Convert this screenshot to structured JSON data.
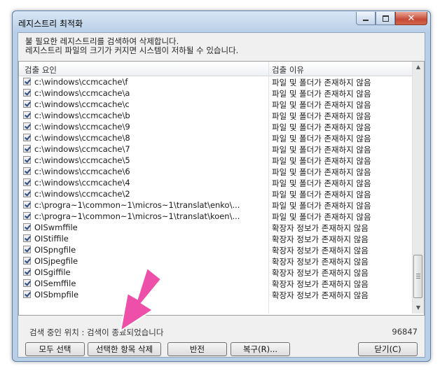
{
  "window": {
    "title": "레지스트리 최적화",
    "close_glyph": "✕"
  },
  "description": [
    "불 필요한 레지스트리를 검색하여 삭제합니다.",
    "레지스트리 파일의 크기가 커지면 시스템이 저하될 수 있습니다."
  ],
  "list": {
    "col_reason": "검출 요인",
    "col_cause": "검출 이유",
    "rows": [
      {
        "reason": "c:\\windows\\ccmcache\\f",
        "cause": "파일 및 폴더가 존재하지 않음"
      },
      {
        "reason": "c:\\windows\\ccmcache\\a",
        "cause": "파일 및 폴더가 존재하지 않음"
      },
      {
        "reason": "c:\\windows\\ccmcache\\c",
        "cause": "파일 및 폴더가 존재하지 않음"
      },
      {
        "reason": "c:\\windows\\ccmcache\\b",
        "cause": "파일 및 폴더가 존재하지 않음"
      },
      {
        "reason": "c:\\windows\\ccmcache\\9",
        "cause": "파일 및 폴더가 존재하지 않음"
      },
      {
        "reason": "c:\\windows\\ccmcache\\8",
        "cause": "파일 및 폴더가 존재하지 않음"
      },
      {
        "reason": "c:\\windows\\ccmcache\\7",
        "cause": "파일 및 폴더가 존재하지 않음"
      },
      {
        "reason": "c:\\windows\\ccmcache\\5",
        "cause": "파일 및 폴더가 존재하지 않음"
      },
      {
        "reason": "c:\\windows\\ccmcache\\6",
        "cause": "파일 및 폴더가 존재하지 않음"
      },
      {
        "reason": "c:\\windows\\ccmcache\\4",
        "cause": "파일 및 폴더가 존재하지 않음"
      },
      {
        "reason": "c:\\windows\\ccmcache\\2",
        "cause": "파일 및 폴더가 존재하지 않음"
      },
      {
        "reason": "c:\\progra~1\\common~1\\micros~1\\translat\\enko\\...",
        "cause": "파일 및 폴더가 존재하지 않음"
      },
      {
        "reason": "c:\\progra~1\\common~1\\micros~1\\translat\\koen\\...",
        "cause": "파일 및 폴더가 존재하지 않음"
      },
      {
        "reason": "OISwmffile",
        "cause": "확장자 정보가 존재하지 않음"
      },
      {
        "reason": "OIStiffile",
        "cause": "확장자 정보가 존재하지 않음"
      },
      {
        "reason": "OISpngfile",
        "cause": "확장자 정보가 존재하지 않음"
      },
      {
        "reason": "OISjpegfile",
        "cause": "확장자 정보가 존재하지 않음"
      },
      {
        "reason": "OISgiffile",
        "cause": "확장자 정보가 존재하지 않음"
      },
      {
        "reason": "OISemffile",
        "cause": "확장자 정보가 존재하지 않음"
      },
      {
        "reason": "OISbmpfile",
        "cause": "확장자 정보가 존재하지 않음"
      }
    ]
  },
  "status": {
    "text": "검색 중인 위치 :  검색이 종료되었습니다",
    "count": "96847"
  },
  "buttons": {
    "select_all": "모두 선택",
    "delete_selected": "선택한 항목 삭제",
    "invert": "반전",
    "restore": "복구(R)...",
    "close": "닫기(C)"
  },
  "colors": {
    "arrow": "#ee4fa8",
    "title_bar": "#b9cfe7"
  }
}
